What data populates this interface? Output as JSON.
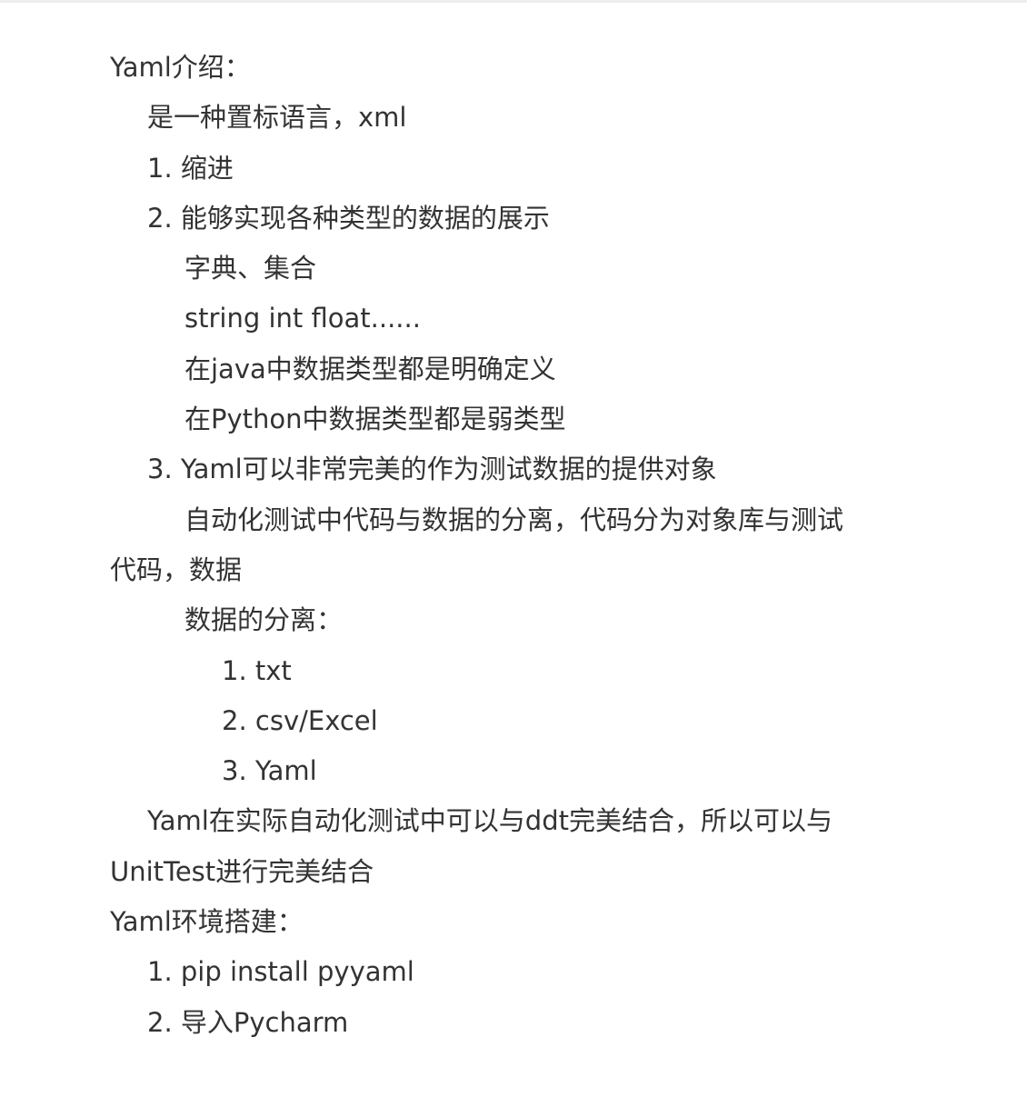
{
  "doc": {
    "intro_heading": "Yaml介绍：",
    "intro_desc": "是一种置标语言，xml",
    "intro_item_1": "1. 缩进",
    "intro_item_2": "2. 能够实现各种类型的数据的展示",
    "types_dict_set": "字典、集合",
    "types_list": "string int float......",
    "java_types": "在java中数据类型都是明确定义",
    "python_types": "在Python中数据类型都是弱类型",
    "intro_item_3": "3. Yaml可以非常完美的作为测试数据的提供对象",
    "separation_line_1": "自动化测试中代码与数据的分离，代码分为对象库与测试",
    "separation_line_2": "代码，数据",
    "separation_heading": "数据的分离：",
    "sep_item_1": "1. txt",
    "sep_item_2": "2. csv/Excel",
    "sep_item_3": "3. Yaml",
    "combine_line_1": "Yaml在实际自动化测试中可以与ddt完美结合，所以可以与",
    "combine_line_2": "UnitTest进行完美结合",
    "env_heading": "Yaml环境搭建：",
    "env_item_1": "1. pip install pyyaml",
    "env_item_2": "2. 导入Pycharm"
  },
  "colors": {
    "text": "#333333",
    "background": "#ffffff"
  }
}
